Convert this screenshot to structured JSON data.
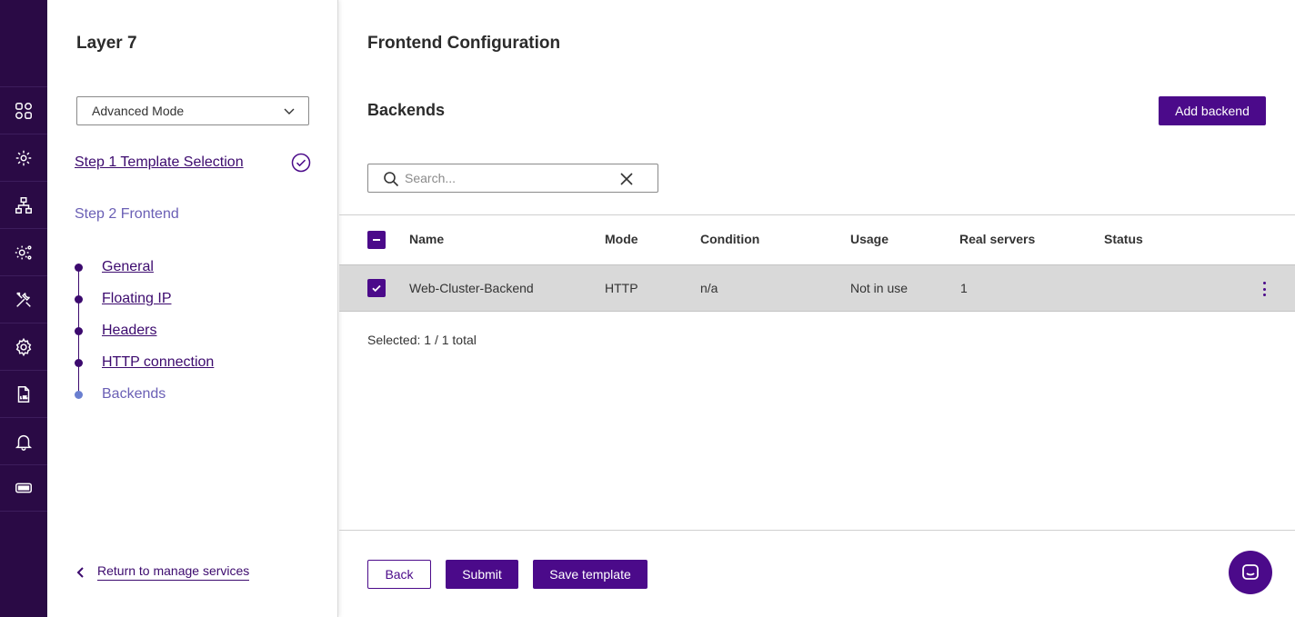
{
  "rail": {
    "items": [
      {
        "icon": "dashboard-grid-icon"
      },
      {
        "icon": "cluster-gear-icon"
      },
      {
        "icon": "network-tree-icon"
      },
      {
        "icon": "services-gear-icon"
      },
      {
        "icon": "tools-icon"
      },
      {
        "icon": "settings-gear-icon"
      },
      {
        "icon": "log-file-icon"
      },
      {
        "icon": "bell-icon"
      },
      {
        "icon": "ticket-icon"
      }
    ]
  },
  "wizard": {
    "title": "Layer 7",
    "mode": "Advanced Mode",
    "step1": "Step 1 Template Selection",
    "step2": "Step 2 Frontend",
    "substeps": [
      "General",
      "Floating IP",
      "Headers",
      "HTTP connection",
      "Backends"
    ],
    "return_link": "Return to manage services"
  },
  "main": {
    "page_title": "Frontend Configuration",
    "section_title": "Backends",
    "add_button": "Add backend",
    "search_placeholder": "Search...",
    "table": {
      "headers": [
        "Name",
        "Mode",
        "Condition",
        "Usage",
        "Real servers",
        "Status"
      ],
      "rows": [
        {
          "name": "Web-Cluster-Backend",
          "mode": "HTTP",
          "condition": "n/a",
          "usage": "Not in use",
          "real_servers": "1",
          "status": ""
        }
      ]
    },
    "selected_text": "Selected: 1 / 1 total"
  },
  "footer": {
    "back": "Back",
    "submit": "Submit",
    "save_template": "Save template"
  },
  "colors": {
    "rail_bg": "#2a0a45",
    "accent": "#4b0a8a",
    "link": "#3c0a6e",
    "current_step": "#6a5fb5",
    "selected_row": "#d9d9d9"
  }
}
